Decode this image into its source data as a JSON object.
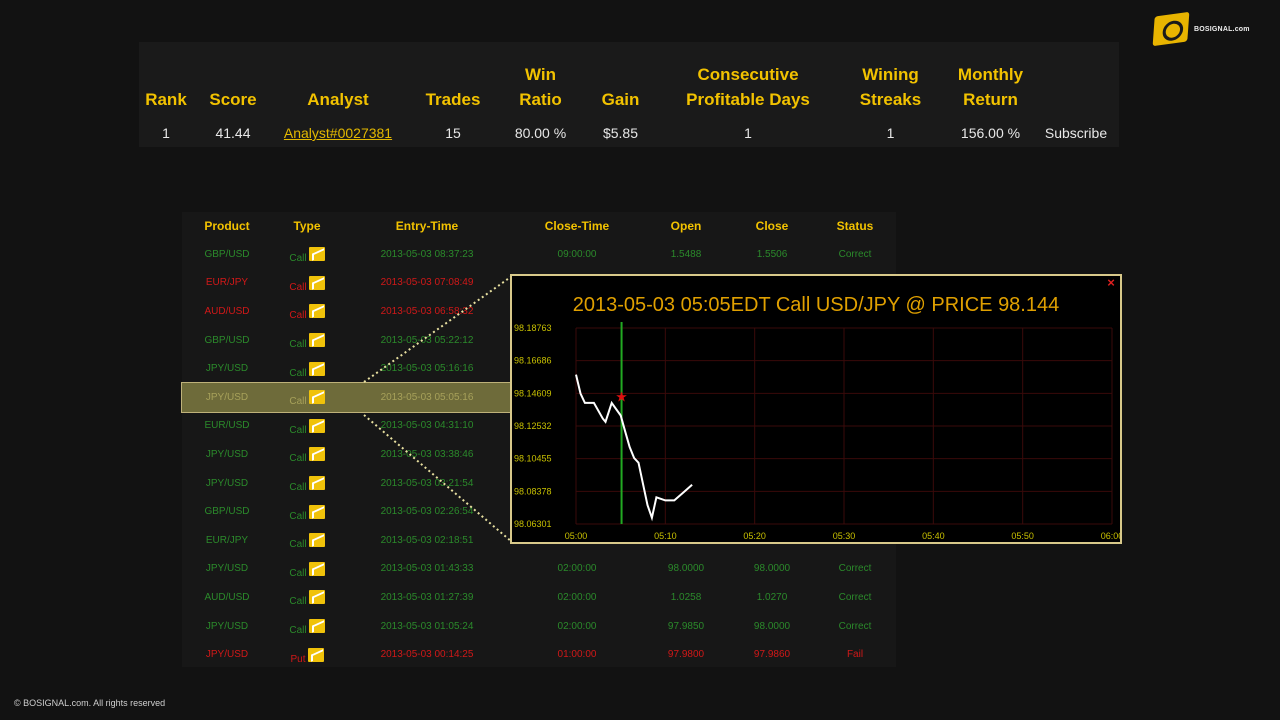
{
  "brand": {
    "logo_text": "BOSIGNAL.com",
    "copyright": "© BOSIGNAL.com.  All rights reserved"
  },
  "ranking": {
    "headers": [
      "Rank",
      "Score",
      "Analyst",
      "Trades",
      "Win Ratio",
      "Gain",
      "Consecutive Profitable Days",
      "Wining Streaks",
      "Monthly Return",
      ""
    ],
    "row": {
      "rank": "1",
      "score": "41.44",
      "analyst": "Analyst#0027381",
      "trades": "15",
      "win_ratio": "80.00 %",
      "gain": "$5.85",
      "consecutive_days": "1",
      "wining_streaks": "1",
      "monthly_return": "156.00 %",
      "subscribe": "Subscribe"
    }
  },
  "trades": {
    "headers": [
      "Product",
      "Type",
      "Entry-Time",
      "Close-Time",
      "Open",
      "Close",
      "Status"
    ],
    "rows": [
      {
        "product": "GBP/USD",
        "type": "Call",
        "entry": "2013-05-03 08:37:23",
        "close_time": "09:00:00",
        "open": "1.5488",
        "close": "1.5506",
        "status": "Correct",
        "color": "green"
      },
      {
        "product": "EUR/JPY",
        "type": "Call",
        "entry": "2013-05-03 07:08:49",
        "close_time": "",
        "open": "",
        "close": "",
        "status": "",
        "color": "red"
      },
      {
        "product": "AUD/USD",
        "type": "Call",
        "entry": "2013-05-03 06:58:32",
        "close_time": "",
        "open": "",
        "close": "",
        "status": "",
        "color": "red"
      },
      {
        "product": "GBP/USD",
        "type": "Call",
        "entry": "2013-05-03 05:22:12",
        "close_time": "",
        "open": "",
        "close": "",
        "status": "",
        "color": "green"
      },
      {
        "product": "JPY/USD",
        "type": "Call",
        "entry": "2013-05-03 05:16:16",
        "close_time": "",
        "open": "",
        "close": "",
        "status": "",
        "color": "green"
      },
      {
        "product": "JPY/USD",
        "type": "Call",
        "entry": "2013-05-03 05:05:16",
        "close_time": "",
        "open": "",
        "close": "",
        "status": "",
        "color": "sel"
      },
      {
        "product": "EUR/USD",
        "type": "Call",
        "entry": "2013-05-03 04:31:10",
        "close_time": "",
        "open": "",
        "close": "",
        "status": "",
        "color": "green"
      },
      {
        "product": "JPY/USD",
        "type": "Call",
        "entry": "2013-05-03 03:38:46",
        "close_time": "",
        "open": "",
        "close": "",
        "status": "",
        "color": "green"
      },
      {
        "product": "JPY/USD",
        "type": "Call",
        "entry": "2013-05-03 03:21:54",
        "close_time": "",
        "open": "",
        "close": "",
        "status": "",
        "color": "green"
      },
      {
        "product": "GBP/USD",
        "type": "Call",
        "entry": "2013-05-03 02:26:54",
        "close_time": "",
        "open": "",
        "close": "",
        "status": "",
        "color": "green"
      },
      {
        "product": "EUR/JPY",
        "type": "Call",
        "entry": "2013-05-03 02:18:51",
        "close_time": "",
        "open": "",
        "close": "",
        "status": "",
        "color": "green"
      },
      {
        "product": "JPY/USD",
        "type": "Call",
        "entry": "2013-05-03 01:43:33",
        "close_time": "02:00:00",
        "open": "98.0000",
        "close": "98.0000",
        "status": "Correct",
        "color": "green"
      },
      {
        "product": "AUD/USD",
        "type": "Call",
        "entry": "2013-05-03 01:27:39",
        "close_time": "02:00:00",
        "open": "1.0258",
        "close": "1.0270",
        "status": "Correct",
        "color": "green"
      },
      {
        "product": "JPY/USD",
        "type": "Call",
        "entry": "2013-05-03 01:05:24",
        "close_time": "02:00:00",
        "open": "97.9850",
        "close": "98.0000",
        "status": "Correct",
        "color": "green"
      },
      {
        "product": "JPY/USD",
        "type": "Put",
        "entry": "2013-05-03 00:14:25",
        "close_time": "01:00:00",
        "open": "97.9800",
        "close": "97.9860",
        "status": "Fail",
        "color": "red"
      }
    ]
  },
  "popup": {
    "title": "2013-05-03 05:05EDT Call USD/JPY @ PRICE 98.144",
    "close_label": "×"
  },
  "chart_data": {
    "type": "line",
    "title": "2013-05-03 05:05EDT Call USD/JPY @ PRICE 98.144",
    "x_tick_labels": [
      "05:00",
      "05:10",
      "05:20",
      "05:30",
      "05:40",
      "05:50",
      "06:00"
    ],
    "y_tick_labels": [
      "98.18763",
      "98.16686",
      "98.14609",
      "98.12532",
      "98.10455",
      "98.08378",
      "98.06301"
    ],
    "ylim": [
      98.06301,
      98.18763
    ],
    "xlim_minutes": [
      0,
      60
    ],
    "series": [
      {
        "x_minutes": [
          0,
          0.5,
          1,
          2,
          3,
          3.3,
          4,
          5,
          5.5,
          6,
          6.5,
          7,
          8,
          8.5,
          9,
          10,
          11,
          12,
          13
        ],
        "values": [
          98.158,
          98.146,
          98.14,
          98.14,
          98.13,
          98.128,
          98.14,
          98.132,
          98.122,
          98.112,
          98.105,
          98.102,
          98.075,
          98.067,
          98.08,
          98.078,
          98.078,
          98.083,
          98.088
        ]
      }
    ],
    "entry_marker": {
      "x_minutes": 5.1,
      "value": 98.144
    },
    "colors": {
      "line": "#ffffff",
      "entry_line": "#22aa22",
      "marker": "#e01010",
      "grid": "#3a0a0a",
      "axis_text": "#c8c000"
    }
  }
}
